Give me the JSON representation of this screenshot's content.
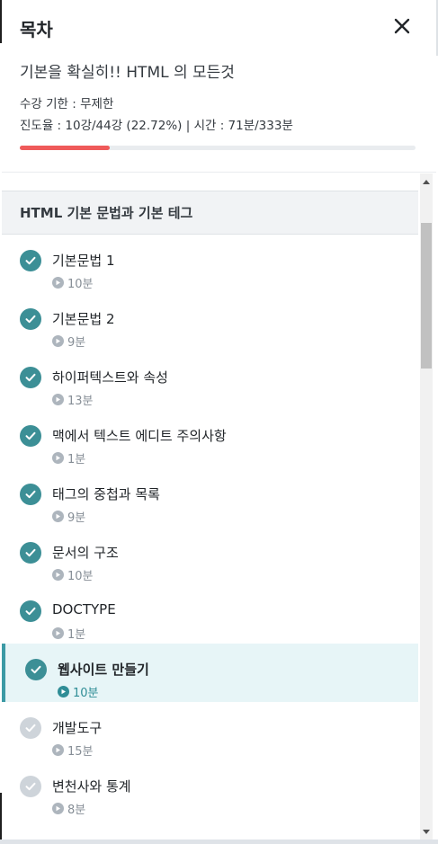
{
  "header": {
    "title": "목차",
    "course_title": "기본을 확실히!! HTML 의 모든것",
    "period_line": "수강 기한 : 무제한",
    "progress_line": "진도율 : 10강/44강 (22.72%) | 시간 : 71분/333분",
    "progress_fraction": 0.2272,
    "progress_color": "#ef5a5a"
  },
  "section": {
    "title": "HTML 기본 문법과 기본 테그"
  },
  "lectures": [
    {
      "title": "기본문법 1",
      "duration": "10분",
      "completed": true
    },
    {
      "title": "기본문법 2",
      "duration": "9분",
      "completed": true
    },
    {
      "title": "하이퍼텍스트와 속성",
      "duration": "13분",
      "completed": true
    },
    {
      "title": "맥에서 텍스트 에디트 주의사항",
      "duration": "1분",
      "completed": true
    },
    {
      "title": "태그의 중첩과 목록",
      "duration": "9분",
      "completed": true
    },
    {
      "title": "문서의 구조",
      "duration": "10분",
      "completed": true
    },
    {
      "title": "DOCTYPE",
      "duration": "1분",
      "completed": true
    },
    {
      "title": "웹사이트 만들기",
      "duration": "10분",
      "completed": true,
      "active": true
    },
    {
      "title": "개발도구",
      "duration": "15분",
      "completed": false
    },
    {
      "title": "변천사와 통계",
      "duration": "8분",
      "completed": false
    }
  ],
  "colors": {
    "accent": "#3c8f96",
    "active_bg": "#e7f5f7",
    "incomplete": "#ced4da"
  },
  "icons": {
    "close": "close-icon",
    "check": "check-circle-icon",
    "play": "play-circle-icon"
  }
}
